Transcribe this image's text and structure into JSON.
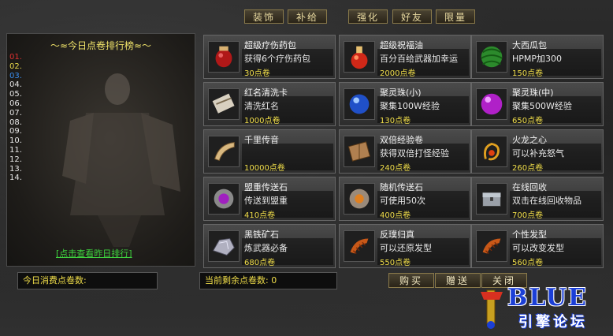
{
  "tabs": [
    "装饰",
    "补给",
    "强化",
    "好友",
    "限量"
  ],
  "ranking": {
    "title": "～≈今日点卷排行榜≈～",
    "numbers": [
      "01.",
      "02.",
      "03.",
      "04.",
      "05.",
      "06.",
      "07.",
      "08.",
      "09.",
      "10.",
      "11.",
      "12.",
      "13.",
      "14."
    ],
    "number_colors": [
      "#e03030",
      "#e8d84a",
      "#3a8ef0",
      "#e8e8e8",
      "#e8e8e8",
      "#e8e8e8",
      "#e8e8e8",
      "#e8e8e8",
      "#e8e8e8",
      "#e8e8e8",
      "#e8e8e8",
      "#e8e8e8",
      "#e8e8e8",
      "#e8e8e8"
    ],
    "yesterday_link": "[点击查看昨日排行]"
  },
  "items": [
    {
      "title": "超级疗伤药包",
      "desc": "获得6个疗伤药包",
      "price": "30点卷",
      "icon": "red-jar-icon"
    },
    {
      "title": "超级祝福油",
      "desc": "百分百给武器加幸运",
      "price": "2000点卷",
      "icon": "red-potion-icon"
    },
    {
      "title": "大西瓜包",
      "desc": "HPMP加300",
      "price": "150点卷",
      "icon": "watermelon-icon"
    },
    {
      "title": "红名清洗卡",
      "desc": "清洗红名",
      "price": "1000点卷",
      "icon": "scroll-icon"
    },
    {
      "title": "聚灵珠(小)",
      "desc": "聚集100W经验",
      "price": "130点卷",
      "icon": "blue-orb-icon"
    },
    {
      "title": "聚灵珠(中)",
      "desc": "聚集500W经验",
      "price": "650点卷",
      "icon": "purple-orb-icon"
    },
    {
      "title": "千里传音",
      "desc": "",
      "price": "10000点卷",
      "icon": "horn-icon"
    },
    {
      "title": "双倍经验卷",
      "desc": "获得双倍打怪经验",
      "price": "240点卷",
      "icon": "book-icon"
    },
    {
      "title": "火龙之心",
      "desc": "可以补充怒气",
      "price": "260点卷",
      "icon": "dragon-heart-icon"
    },
    {
      "title": "盟重传送石",
      "desc": "传送到盟重",
      "price": "410点卷",
      "icon": "purple-stone-icon"
    },
    {
      "title": "随机传送石",
      "desc": "可使用50次",
      "price": "400点卷",
      "icon": "orange-stone-icon"
    },
    {
      "title": "在线回收",
      "desc": "双击在线回收物品",
      "price": "700点卷",
      "icon": "chest-icon"
    },
    {
      "title": "黑铁矿石",
      "desc": "炼武器必备",
      "price": "680点卷",
      "icon": "ore-icon"
    },
    {
      "title": "反璞归真",
      "desc": "可以还原发型",
      "price": "550点卷",
      "icon": "comb-icon"
    },
    {
      "title": "个性发型",
      "desc": "可以改变发型",
      "price": "560点卷",
      "icon": "comb-icon"
    }
  ],
  "bottom": {
    "today_spent_label": "今日消费点卷数:",
    "remaining_label": "当前剩余点卷数: 0"
  },
  "buttons": {
    "buy": "购买",
    "gift": "赠送",
    "close": "关闭"
  },
  "logo": {
    "main": "BLUE",
    "sub": "引擎论坛"
  }
}
